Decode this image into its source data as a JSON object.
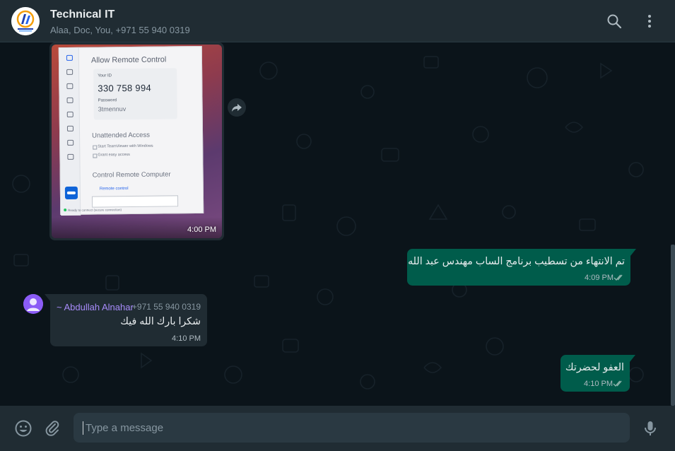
{
  "header": {
    "title": "Technical IT",
    "subtitle": "Alaa, Doc, You, +971 55 940 0319"
  },
  "image_message": {
    "time": "4:00 PM",
    "screenshot": {
      "heading": "Allow Remote Control",
      "id_label": "Your ID",
      "id_value": "330 758 994",
      "password_label": "Password",
      "password_value": "3tmennuv",
      "unattended_heading": "Unattended Access",
      "check1": "Start TeamViewer with Windows",
      "check2": "Grant easy access",
      "control_heading": "Control Remote Computer",
      "control_link": "Remote control",
      "status": "Ready to connect (secure connection)"
    }
  },
  "messages": [
    {
      "direction": "out",
      "text": "تم الانتهاء من تسطيب برنامج الساب مهندس عبد الله",
      "time": "4:09 PM",
      "status": "read"
    },
    {
      "direction": "in",
      "sender": "~ Abdullah Alnahar",
      "phone": "+971 55 940 0319",
      "text": "شكرا بارك الله فيك",
      "time": "4:10 PM"
    },
    {
      "direction": "out",
      "text": "العفو لحضرتك",
      "time": "4:10 PM",
      "status": "read"
    }
  ],
  "composer": {
    "placeholder": "Type a message",
    "value": ""
  },
  "icons": {
    "search": "search-icon",
    "menu": "kebab-menu-icon",
    "forward": "forward-icon",
    "emoji": "emoji-icon",
    "attach": "paperclip-icon",
    "mic": "microphone-icon",
    "read_receipt": "double-check-icon"
  },
  "colors": {
    "background": "#0b141a",
    "panel": "#202c33",
    "outgoing_bubble": "#005c4b",
    "incoming_bubble": "#202c33",
    "sender_name": "#a78bfa",
    "tick_read": "#8696a0"
  }
}
